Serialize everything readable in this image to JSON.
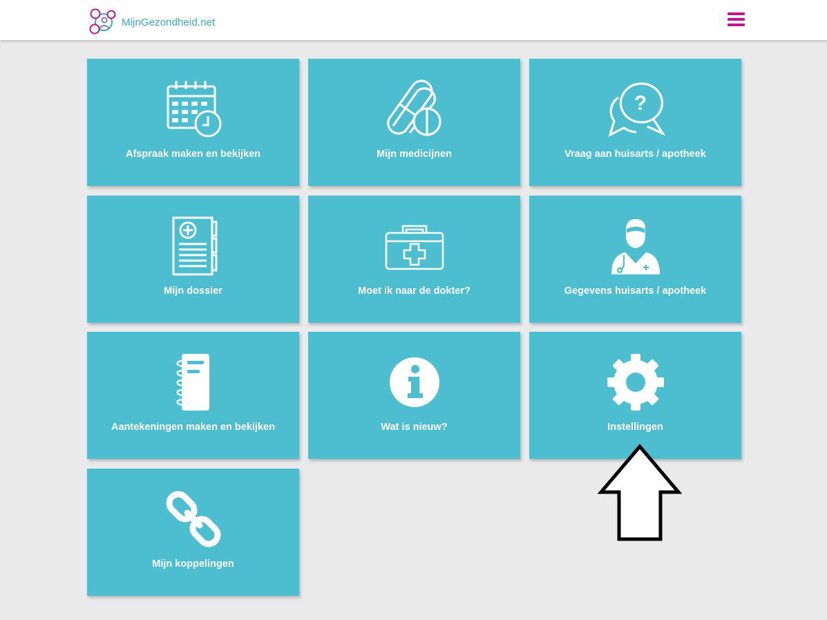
{
  "header": {
    "logo_text": "MijnGezondheid.net",
    "menu_icon": "hamburger-menu-icon",
    "colors": {
      "brand": "#c4168a",
      "logo_text": "#3aa9c4"
    }
  },
  "tiles": [
    {
      "label": "Afspraak maken en bekijken",
      "icon": "calendar-clock-icon"
    },
    {
      "label": "Mijn medicijnen",
      "icon": "pills-icon"
    },
    {
      "label": "Vraag aan huisarts / apotheek",
      "icon": "speech-bubble-question-icon"
    },
    {
      "label": "Mijn dossier",
      "icon": "medical-record-icon"
    },
    {
      "label": "Moet ik naar de dokter?",
      "icon": "first-aid-kit-icon"
    },
    {
      "label": "Gegevens huisarts / apotheek",
      "icon": "doctor-icon"
    },
    {
      "label": "Aantekeningen maken en bekijken",
      "icon": "notebook-icon"
    },
    {
      "label": "Wat is nieuw?",
      "icon": "info-icon"
    },
    {
      "label": "Instellingen",
      "icon": "gear-icon"
    },
    {
      "label": "Mijn koppelingen",
      "icon": "chain-link-icon"
    }
  ],
  "annotation": {
    "icon": "up-arrow-icon",
    "points_to": "Instellingen"
  },
  "colors": {
    "tile": "#4dbdd0",
    "background": "#eaeaea",
    "tile_text": "#ffffff"
  }
}
